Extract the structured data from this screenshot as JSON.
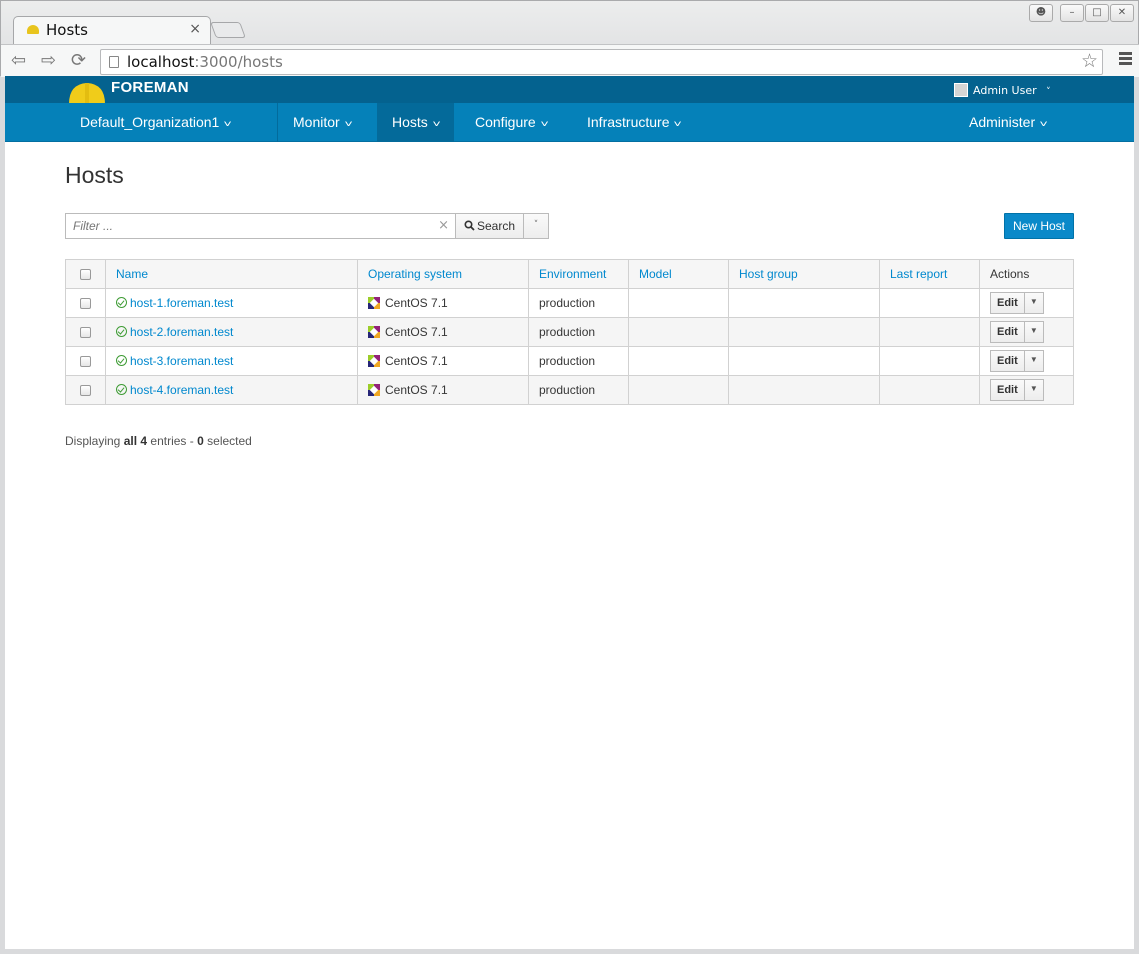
{
  "browser": {
    "tab_title": "Hosts",
    "tab_close": "×",
    "url_host": "localhost",
    "url_path": ":3000/hosts"
  },
  "header": {
    "brand": "FOREMAN",
    "user": "Admin User",
    "user_caret": "˅"
  },
  "nav": {
    "org": "Default_Organization1",
    "items": [
      "Monitor",
      "Hosts",
      "Configure",
      "Infrastructure"
    ],
    "admin": "Administer",
    "active": "Hosts",
    "caret": "˅"
  },
  "page": {
    "title": "Hosts",
    "filter_placeholder": "Filter ...",
    "filter_clear": "×",
    "search_label": "Search",
    "new_host_label": "New Host"
  },
  "table": {
    "headers": {
      "name": "Name",
      "os": "Operating system",
      "env": "Environment",
      "model": "Model",
      "hostgroup": "Host group",
      "last_report": "Last report",
      "actions": "Actions"
    },
    "rows": [
      {
        "name": "host-1.foreman.test",
        "os": "CentOS 7.1",
        "env": "production",
        "model": "",
        "hostgroup": "",
        "last_report": "",
        "action": "Edit"
      },
      {
        "name": "host-2.foreman.test",
        "os": "CentOS 7.1",
        "env": "production",
        "model": "",
        "hostgroup": "",
        "last_report": "",
        "action": "Edit"
      },
      {
        "name": "host-3.foreman.test",
        "os": "CentOS 7.1",
        "env": "production",
        "model": "",
        "hostgroup": "",
        "last_report": "",
        "action": "Edit"
      },
      {
        "name": "host-4.foreman.test",
        "os": "CentOS 7.1",
        "env": "production",
        "model": "",
        "hostgroup": "",
        "last_report": "",
        "action": "Edit"
      }
    ]
  },
  "footer": {
    "prefix": "Displaying",
    "count": "all 4",
    "mid": "entries -",
    "selected": "0",
    "suffix": "selected"
  },
  "colors": {
    "topbar": "#04628f",
    "navbar": "#0581b9",
    "link": "#0088ce",
    "primary_button": "#0a89c9",
    "status_ok": "#3f9c35"
  }
}
